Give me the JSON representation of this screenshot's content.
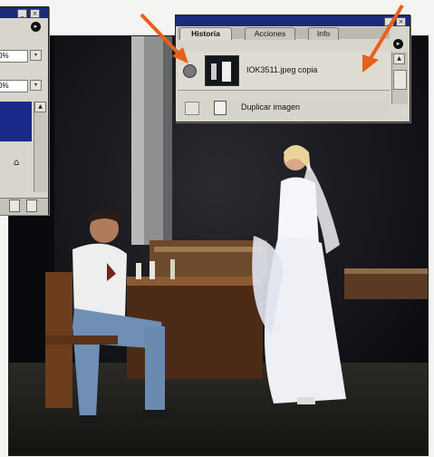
{
  "history_palette": {
    "tabs": [
      "Historia",
      "Acciones",
      "Info"
    ],
    "snapshot_label": "IOK3511.jpeg copia",
    "step_label": "Duplicar imagen"
  },
  "left_palette": {
    "percent_1": "0%",
    "percent_2": "0%"
  },
  "colors": {
    "titlebar": "#1b2a7a",
    "palette_bg": "#d8d6cc",
    "arrow": "#e8601c"
  },
  "icons": [
    "minimize-icon",
    "close-icon",
    "palette-menu-icon",
    "snapshot-brush-icon",
    "snapshot-thumbnail",
    "duplicate-image-icon",
    "scroll-up-icon",
    "scroll-down-icon",
    "arrow-pointer-icon"
  ]
}
